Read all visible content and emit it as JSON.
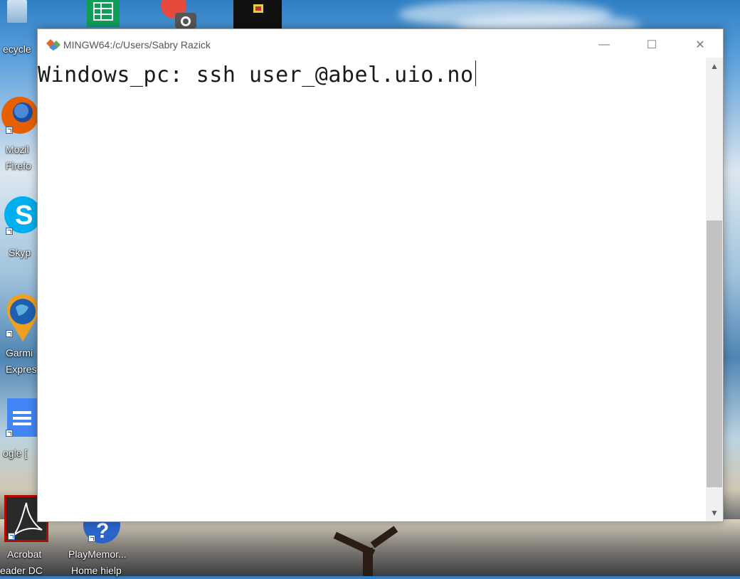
{
  "window": {
    "title": "MINGW64:/c/Users/Sabry Razick",
    "controls": {
      "minimize": "—",
      "maximize": "☐",
      "close": "✕"
    }
  },
  "terminal": {
    "command_line": "Windows_pc: ssh user_@abel.uio.no"
  },
  "scrollbar": {
    "up_arrow": "▲",
    "down_arrow": "▼",
    "thumb_top_fraction": 0.34,
    "thumb_height_fraction": 0.62
  },
  "desktop_icons": [
    {
      "line1": "ecycle",
      "line2": ""
    },
    {
      "line1": "Mozil",
      "line2": "Firefo"
    },
    {
      "line1": "Skyp",
      "line2": ""
    },
    {
      "line1": "Garmi",
      "line2": "Expres"
    },
    {
      "line1": "ogle [",
      "line2": ""
    },
    {
      "line1": "Acrobat",
      "line2": "eader DC"
    },
    {
      "line1": "PlayMemor...",
      "line2": "Home hielp"
    }
  ],
  "colors": {
    "accent_firefox": "#e66000",
    "skype": "#00aff0",
    "sheets": "#0f9d58",
    "docs": "#4285f4",
    "acrobat": "#b30b00"
  }
}
